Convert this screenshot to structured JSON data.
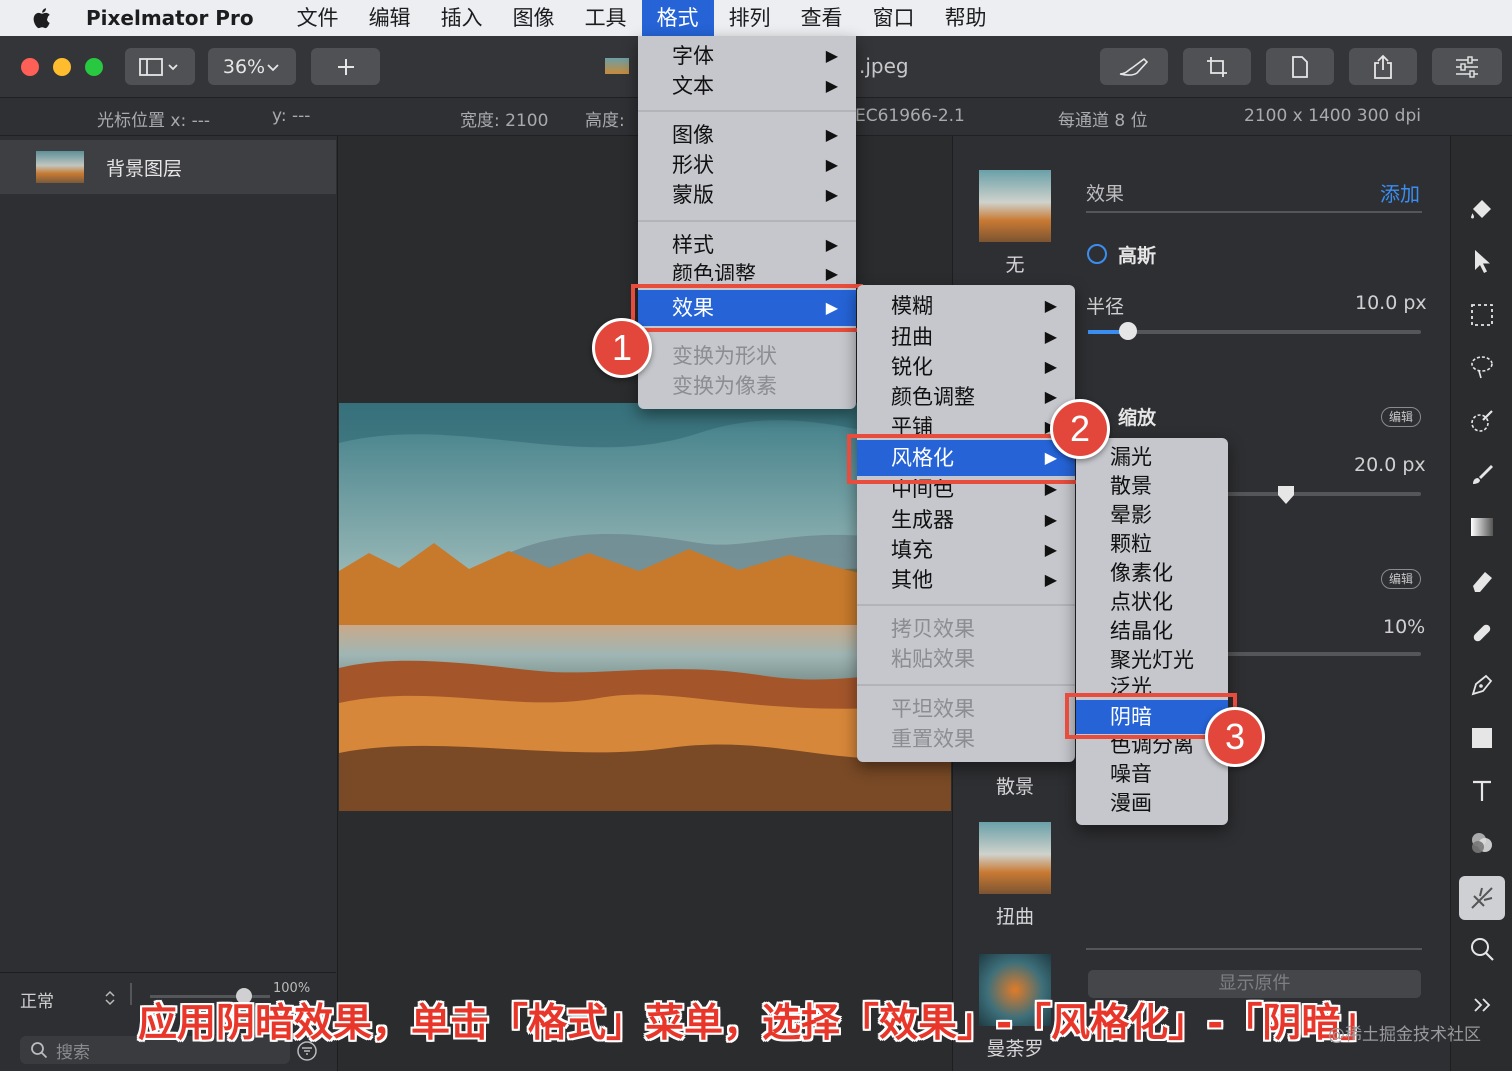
{
  "menubar": {
    "app_name": "Pixelmator Pro",
    "items": [
      "文件",
      "编辑",
      "插入",
      "图像",
      "工具",
      "格式",
      "排列",
      "查看",
      "窗口",
      "帮助"
    ],
    "active_index": 5
  },
  "toolbar": {
    "zoom": "36%",
    "doc_title": ".jpeg"
  },
  "infobar": {
    "cursor_x": "光标位置 x:  ---",
    "cursor_y": "y:  ---",
    "width": "宽度:  2100",
    "height": "高度:",
    "profile": "EC61966-2.1",
    "depth": "每通道 8 位",
    "size": "2100 x 1400 300 dpi"
  },
  "layers": {
    "items": [
      {
        "name": "背景图层"
      }
    ],
    "blend_mode": "正常",
    "opacity": "100%",
    "search_placeholder": "搜索"
  },
  "effects_panel": {
    "header": "效果",
    "add_label": "添加",
    "thumbs": [
      "无",
      "散景",
      "扭曲",
      "曼荼罗"
    ],
    "gaussian_label": "高斯",
    "radius_label": "半径",
    "radius_value": "10.0 px",
    "zoom_label": "缩放",
    "edit_label": "编辑",
    "value2": "20.0 px",
    "value3": "10%",
    "show_original": "显示原件"
  },
  "format_menu": {
    "items": [
      "字体",
      "文本",
      "图像",
      "形状",
      "蒙版",
      "样式",
      "颜色调整",
      "效果",
      "变换为形状",
      "变换为像素"
    ]
  },
  "effects_submenu": {
    "items": [
      "模糊",
      "扭曲",
      "锐化",
      "颜色调整",
      "平铺",
      "风格化",
      "中间色",
      "生成器",
      "填充",
      "其他",
      "拷贝效果",
      "粘贴效果",
      "平坦效果",
      "重置效果"
    ]
  },
  "stylize_submenu": {
    "items": [
      "漏光",
      "散景",
      "晕影",
      "颗粒",
      "像素化",
      "点状化",
      "结晶化",
      "聚光灯光",
      "泛光",
      "阴暗",
      "色调分离",
      "噪音",
      "漫画"
    ]
  },
  "badges": [
    "1",
    "2",
    "3"
  ],
  "caption": "应用阴暗效果，单击「格式」菜单，选择「效果」-「风格化」-「阴暗」",
  "watermark": "@稀土掘金技术社区",
  "colors": {
    "accent": "#2563d6",
    "highlight_red": "#e74c3c",
    "add_link": "#3b8ef0"
  }
}
